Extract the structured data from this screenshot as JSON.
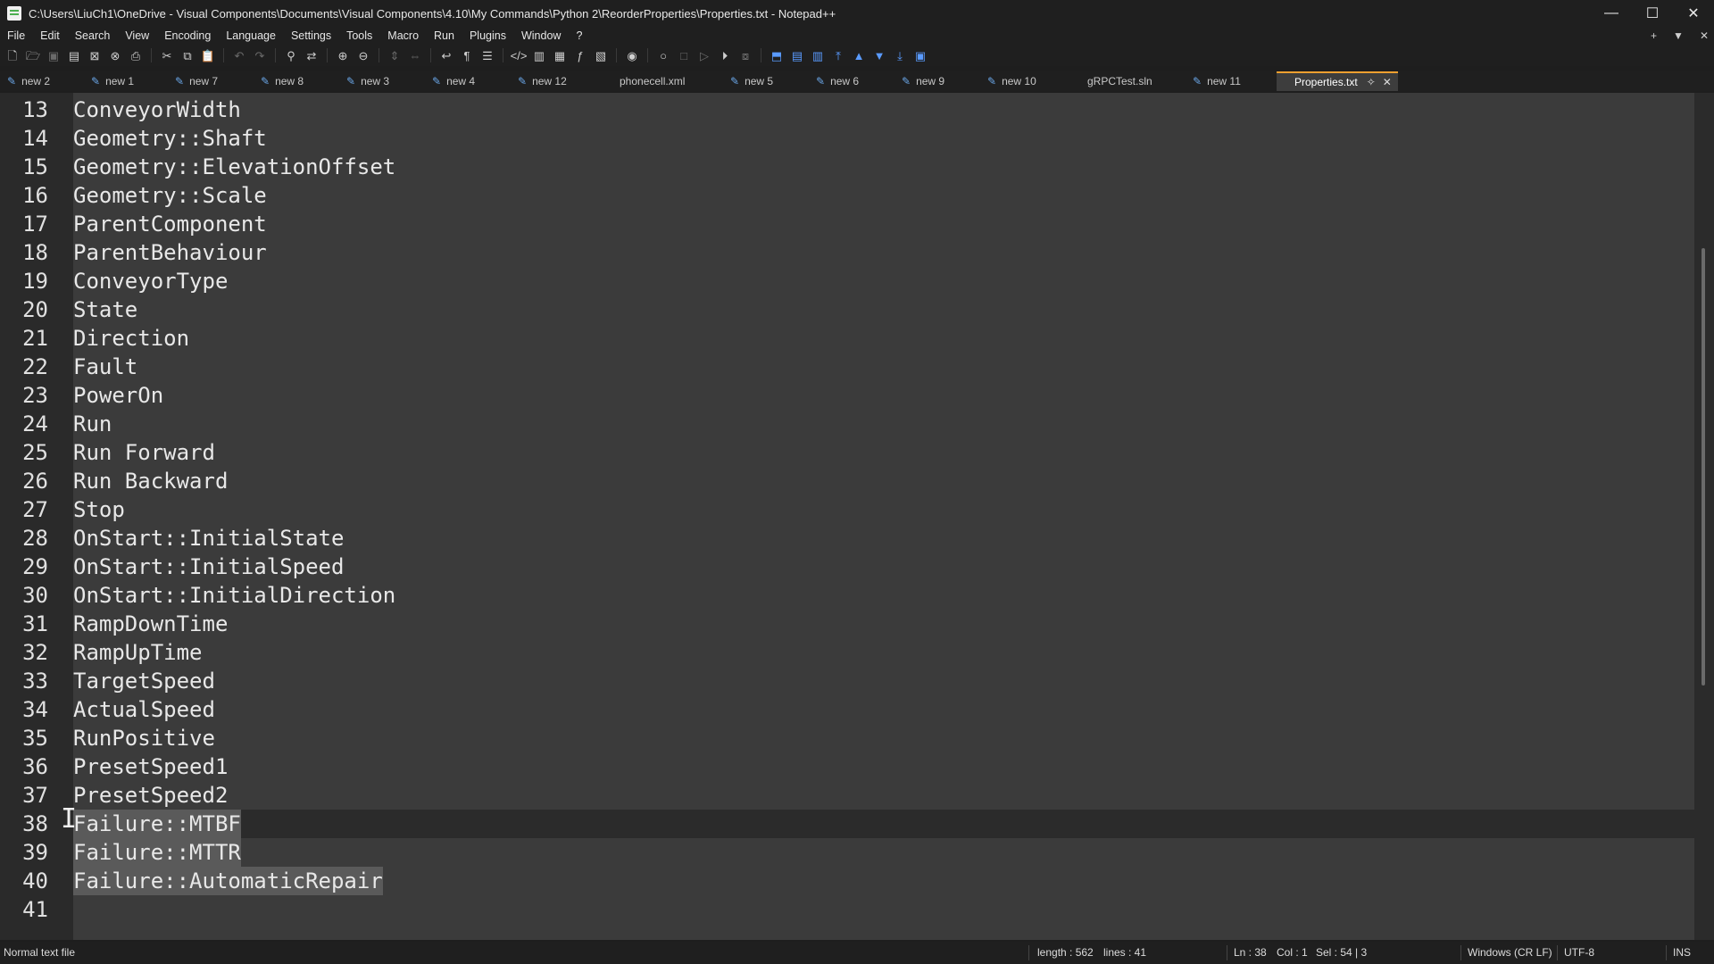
{
  "window": {
    "title": "C:\\Users\\LiuCh1\\OneDrive - Visual Components\\Documents\\Visual Components\\4.10\\My Commands\\Python 2\\ReorderProperties\\Properties.txt - Notepad++",
    "controls": [
      "—",
      "☐",
      "✕"
    ]
  },
  "menu": {
    "items": [
      "File",
      "Edit",
      "Search",
      "View",
      "Encoding",
      "Language",
      "Settings",
      "Tools",
      "Macro",
      "Run",
      "Plugins",
      "Window",
      "?"
    ],
    "right": [
      "+",
      "▼",
      "✕"
    ]
  },
  "toolbar": {
    "icons": [
      "new-file-icon",
      "open-file-icon",
      "save-icon",
      "save-all-icon",
      "close-icon",
      "close-all-icon",
      "print-icon",
      "cut-icon",
      "copy-icon",
      "paste-icon",
      "undo-icon",
      "redo-icon",
      "find-icon",
      "replace-icon",
      "zoom-in-icon",
      "zoom-out-icon",
      "sync-v-icon",
      "sync-h-icon",
      "wrap-icon",
      "show-all-chars-icon",
      "indent-guide-icon",
      "xml-icon",
      "map-icon",
      "doc-list-icon",
      "function-list-icon",
      "folder-workspace-icon",
      "monitor-icon",
      "record-icon",
      "stop-icon",
      "play-icon",
      "play-multi-icon",
      "save-macro-icon"
    ]
  },
  "tabs": [
    {
      "label": "new 2",
      "modified": true
    },
    {
      "label": "new 1",
      "modified": true
    },
    {
      "label": "new 7",
      "modified": true
    },
    {
      "label": "new 8",
      "modified": true
    },
    {
      "label": "new 3",
      "modified": true
    },
    {
      "label": "new 4",
      "modified": true
    },
    {
      "label": "new 12",
      "modified": true
    },
    {
      "label": "phonecell.xml",
      "modified": false
    },
    {
      "label": "new 5",
      "modified": true
    },
    {
      "label": "new 6",
      "modified": true
    },
    {
      "label": "new 9",
      "modified": true
    },
    {
      "label": "new 10",
      "modified": true
    },
    {
      "label": "gRPCTest.sln",
      "modified": false
    },
    {
      "label": "new 11",
      "modified": true
    },
    {
      "label": "Properties.txt",
      "modified": false,
      "active": true
    }
  ],
  "editor": {
    "lines": [
      {
        "n": "13",
        "text": "ConveyorWidth"
      },
      {
        "n": "14",
        "text": "Geometry::Shaft"
      },
      {
        "n": "15",
        "text": "Geometry::ElevationOffset"
      },
      {
        "n": "16",
        "text": "Geometry::Scale"
      },
      {
        "n": "17",
        "text": "ParentComponent"
      },
      {
        "n": "18",
        "text": "ParentBehaviour"
      },
      {
        "n": "19",
        "text": "ConveyorType"
      },
      {
        "n": "20",
        "text": "State"
      },
      {
        "n": "21",
        "text": "Direction"
      },
      {
        "n": "22",
        "text": "Fault"
      },
      {
        "n": "23",
        "text": "PowerOn"
      },
      {
        "n": "24",
        "text": "Run"
      },
      {
        "n": "25",
        "text": "Run Forward"
      },
      {
        "n": "26",
        "text": "Run Backward"
      },
      {
        "n": "27",
        "text": "Stop"
      },
      {
        "n": "28",
        "text": "OnStart::InitialState"
      },
      {
        "n": "29",
        "text": "OnStart::InitialSpeed"
      },
      {
        "n": "30",
        "text": "OnStart::InitialDirection"
      },
      {
        "n": "31",
        "text": "RampDownTime"
      },
      {
        "n": "32",
        "text": "RampUpTime"
      },
      {
        "n": "33",
        "text": "TargetSpeed"
      },
      {
        "n": "34",
        "text": "ActualSpeed"
      },
      {
        "n": "35",
        "text": "RunPositive"
      },
      {
        "n": "36",
        "text": "PresetSpeed1"
      },
      {
        "n": "37",
        "text": "PresetSpeed2"
      },
      {
        "n": "38",
        "text": "Failure::MTBF",
        "selected": true,
        "caret": true
      },
      {
        "n": "39",
        "text": "Failure::MTTR",
        "selected": true
      },
      {
        "n": "40",
        "text": "Failure::AutomaticRepair",
        "selected": true
      },
      {
        "n": "41",
        "text": ""
      }
    ]
  },
  "status": {
    "file_type": "Normal text file",
    "length": "length : 562",
    "lines": "lines : 41",
    "ln": "Ln : 38",
    "col": "Col : 1",
    "sel": "Sel : 54 | 3",
    "eol": "Windows (CR LF)",
    "encoding": "UTF-8",
    "mode": "INS"
  },
  "colors": {
    "editor_bg": "#3b3b3b",
    "gutter_bg": "#2a2a2a",
    "selection": "#5a5a5a",
    "active_tab_accent": "#f0a030"
  }
}
